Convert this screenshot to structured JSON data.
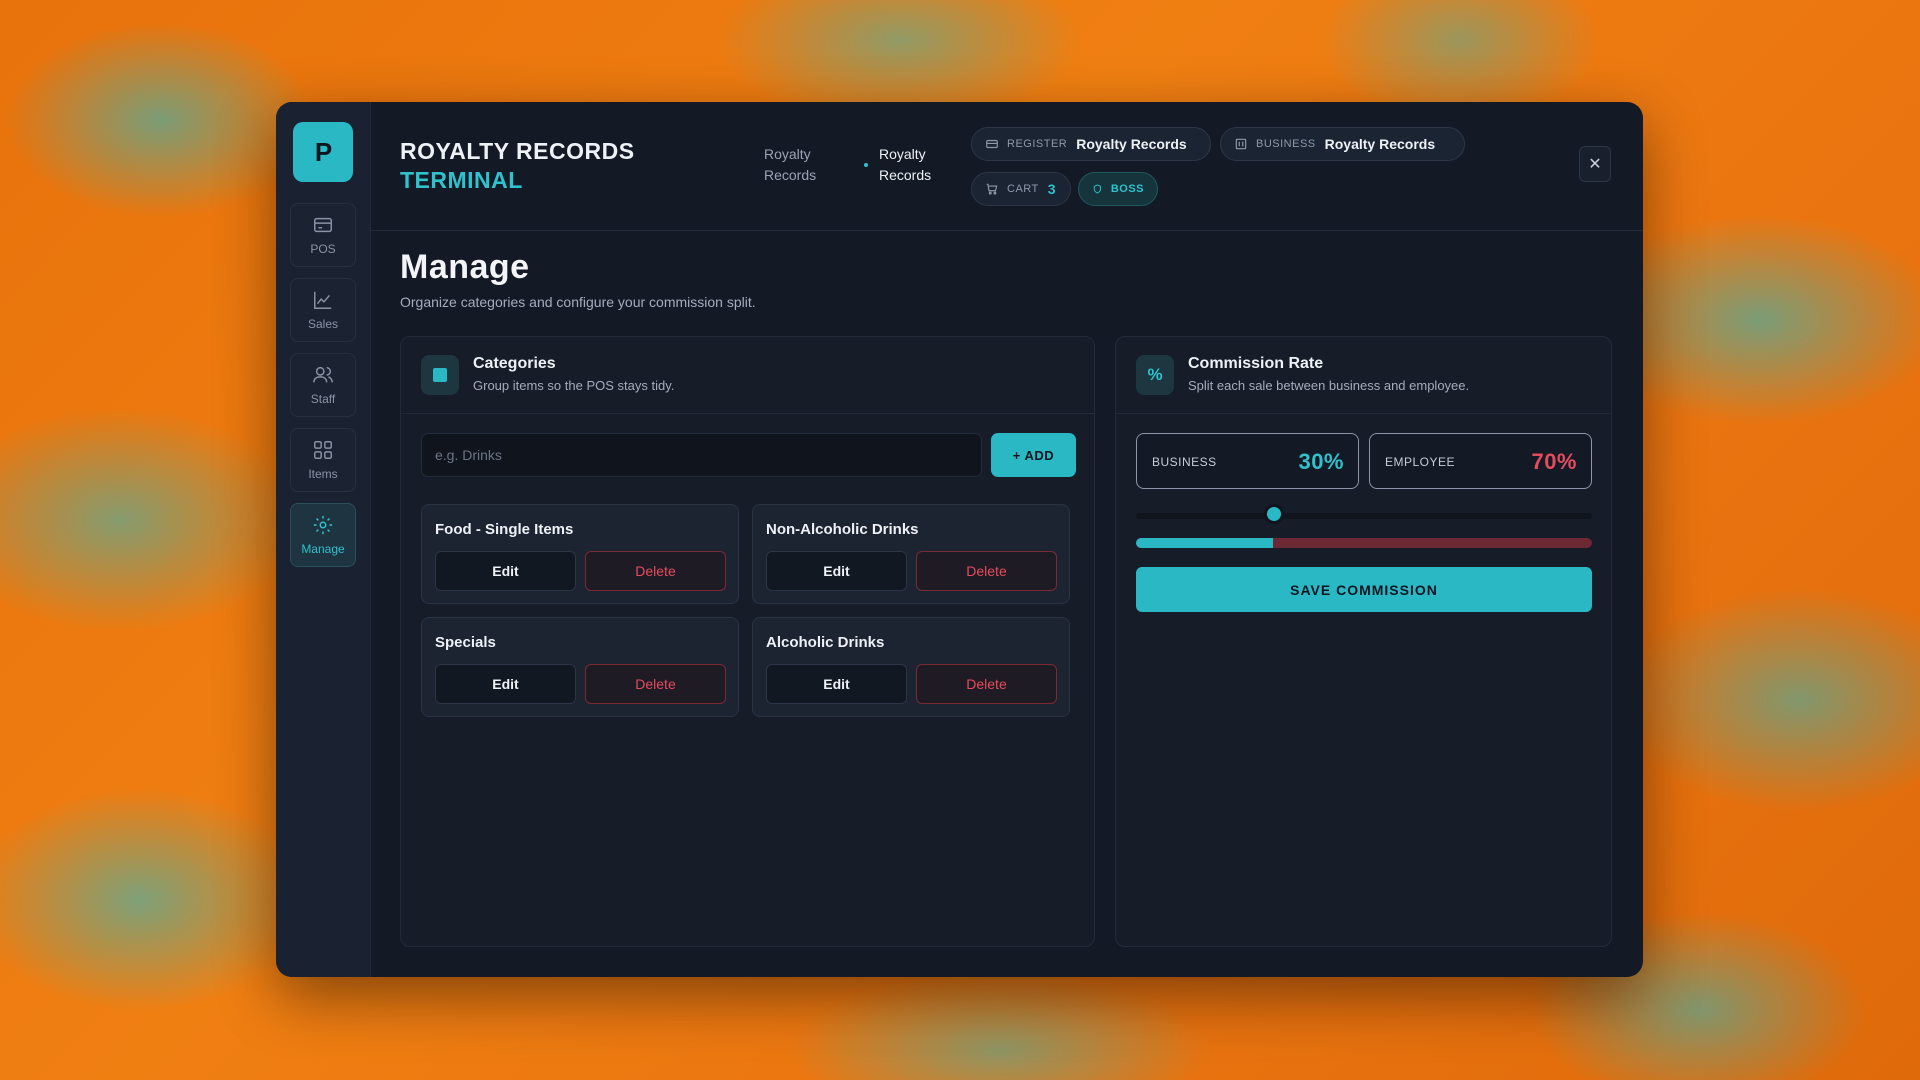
{
  "header": {
    "brand_line1": "ROYALTY RECORDS",
    "brand_line2": "TERMINAL",
    "breadcrumb": [
      "Royalty Records",
      "Royalty Records"
    ],
    "register_label": "REGISTER",
    "register_value": "Royalty Records",
    "business_label": "BUSINESS",
    "business_value": "Royalty Records",
    "cart_label": "CART",
    "cart_count": "3",
    "role_label": "BOSS",
    "close_glyph": "✕"
  },
  "sidebar": {
    "logo_text": "P",
    "items": [
      {
        "label": "POS",
        "icon": "register-icon"
      },
      {
        "label": "Sales",
        "icon": "chart-icon"
      },
      {
        "label": "Staff",
        "icon": "users-icon"
      },
      {
        "label": "Items",
        "icon": "grid-icon"
      },
      {
        "label": "Manage",
        "icon": "gear-icon",
        "active": true
      }
    ]
  },
  "page": {
    "title": "Manage",
    "subtitle": "Organize categories and configure your commission split."
  },
  "categories": {
    "title": "Categories",
    "subtitle": "Group items so the POS stays tidy.",
    "input_placeholder": "e.g. Drinks",
    "add_label": "+ ADD",
    "edit_label": "Edit",
    "delete_label": "Delete",
    "items": [
      "Food - Single Items",
      "Non-Alcoholic Drinks",
      "Specials",
      "Alcoholic Drinks"
    ]
  },
  "commission": {
    "title": "Commission Rate",
    "subtitle": "Split each sale between business and employee.",
    "icon_glyph": "%",
    "business_label": "BUSINESS",
    "business_value": "30%",
    "employee_label": "EMPLOYEE",
    "employee_value": "70%",
    "business_fraction": 0.3,
    "save_label": "SAVE COMMISSION"
  },
  "colors": {
    "accent": "#2ab8c4",
    "danger": "#e44c5d",
    "background": "#141a25"
  }
}
